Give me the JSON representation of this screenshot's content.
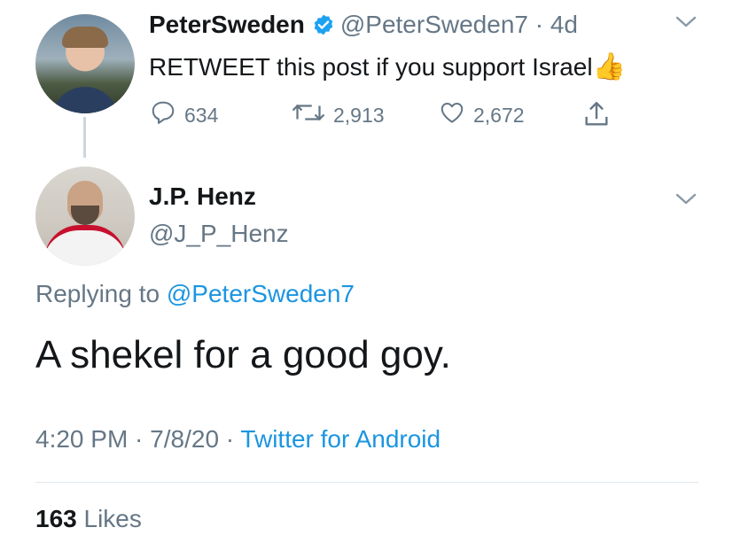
{
  "original_tweet": {
    "display_name": "PeterSweden",
    "handle": "@PeterSweden7",
    "age": "4d",
    "text": "RETWEET this post if you support Israel",
    "emoji": "👍",
    "reply_count": "634",
    "retweet_count": "2,913",
    "like_count": "2,672"
  },
  "reply_tweet": {
    "display_name": "J.P. Henz",
    "handle": "@J_P_Henz",
    "replying_prefix": "Replying to ",
    "replying_to": "@PeterSweden7",
    "text": "A shekel for a good goy.",
    "time": "4:20 PM",
    "date": "7/8/20",
    "source": "Twitter for Android",
    "likes_count": "163",
    "likes_label": "Likes"
  },
  "colors": {
    "link": "#1b95e0",
    "secondary_text": "#657786",
    "verified_badge": "#1da1f2"
  }
}
